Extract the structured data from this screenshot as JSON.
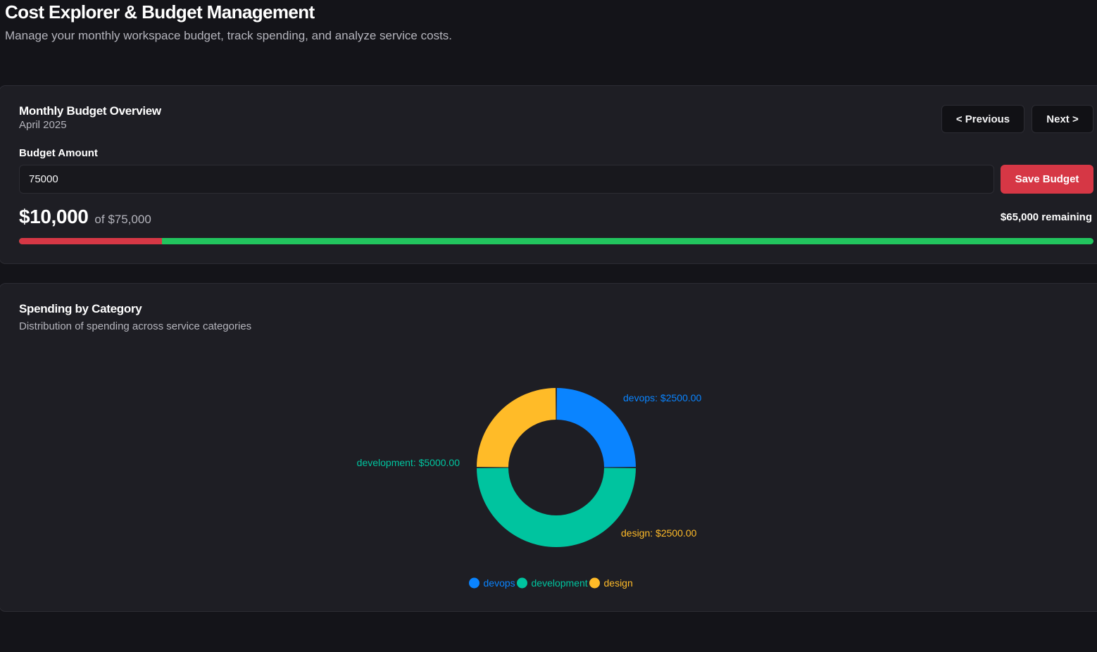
{
  "header": {
    "title": "Cost Explorer & Budget Management",
    "subtitle": "Manage your monthly workspace budget, track spending, and analyze service costs."
  },
  "budget": {
    "title": "Monthly Budget Overview",
    "month": "April 2025",
    "prev_label": "< Previous",
    "next_label": "Next >",
    "amount_label": "Budget Amount",
    "input_value": "75000",
    "save_label": "Save Budget",
    "spent_display": "$10,000",
    "of_display": "of $75,000",
    "remaining_display": "$65,000 remaining",
    "progress_fraction": 0.1333,
    "colors": {
      "spent": "#d63745",
      "remaining": "#22c55e"
    }
  },
  "spending": {
    "title": "Spending by Category",
    "subtitle": "Distribution of spending across service categories"
  },
  "chart_data": {
    "type": "pie",
    "title": "",
    "categories": [
      "devops",
      "development",
      "design"
    ],
    "values": [
      2500,
      5000,
      2500
    ],
    "data_labels": [
      "devops: $2500.00",
      "development: $5000.00",
      "design: $2500.00"
    ],
    "colors": [
      "#0a84ff",
      "#00c49f",
      "#ffbb28"
    ],
    "legend_position": "bottom"
  }
}
